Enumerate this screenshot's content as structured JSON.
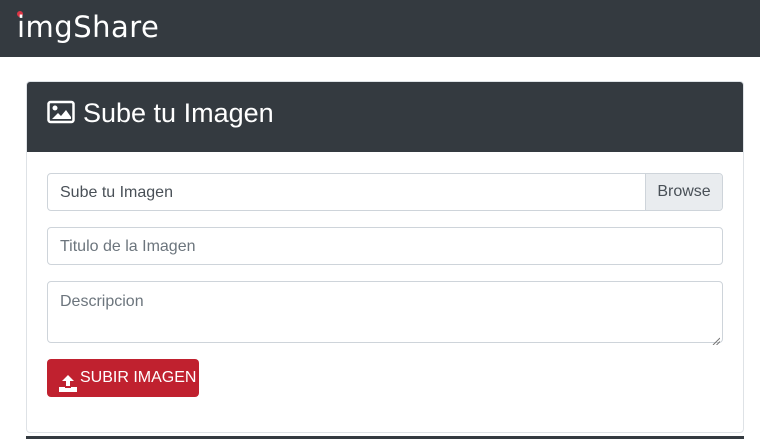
{
  "navbar": {
    "brand": "imgShare"
  },
  "card": {
    "title": "Sube tu Imagen",
    "title_icon": "image-icon"
  },
  "form": {
    "file_label": "Sube tu Imagen",
    "browse_label": "Browse",
    "title_placeholder": "Titulo de la Imagen",
    "description_placeholder": "Descripcion",
    "submit_label": "SUBIR IMAGEN",
    "submit_icon": "upload-icon"
  },
  "colors": {
    "navbar_bg": "#343a40",
    "submit_bg": "#c0212f",
    "brand_dot": "#dc3545"
  }
}
